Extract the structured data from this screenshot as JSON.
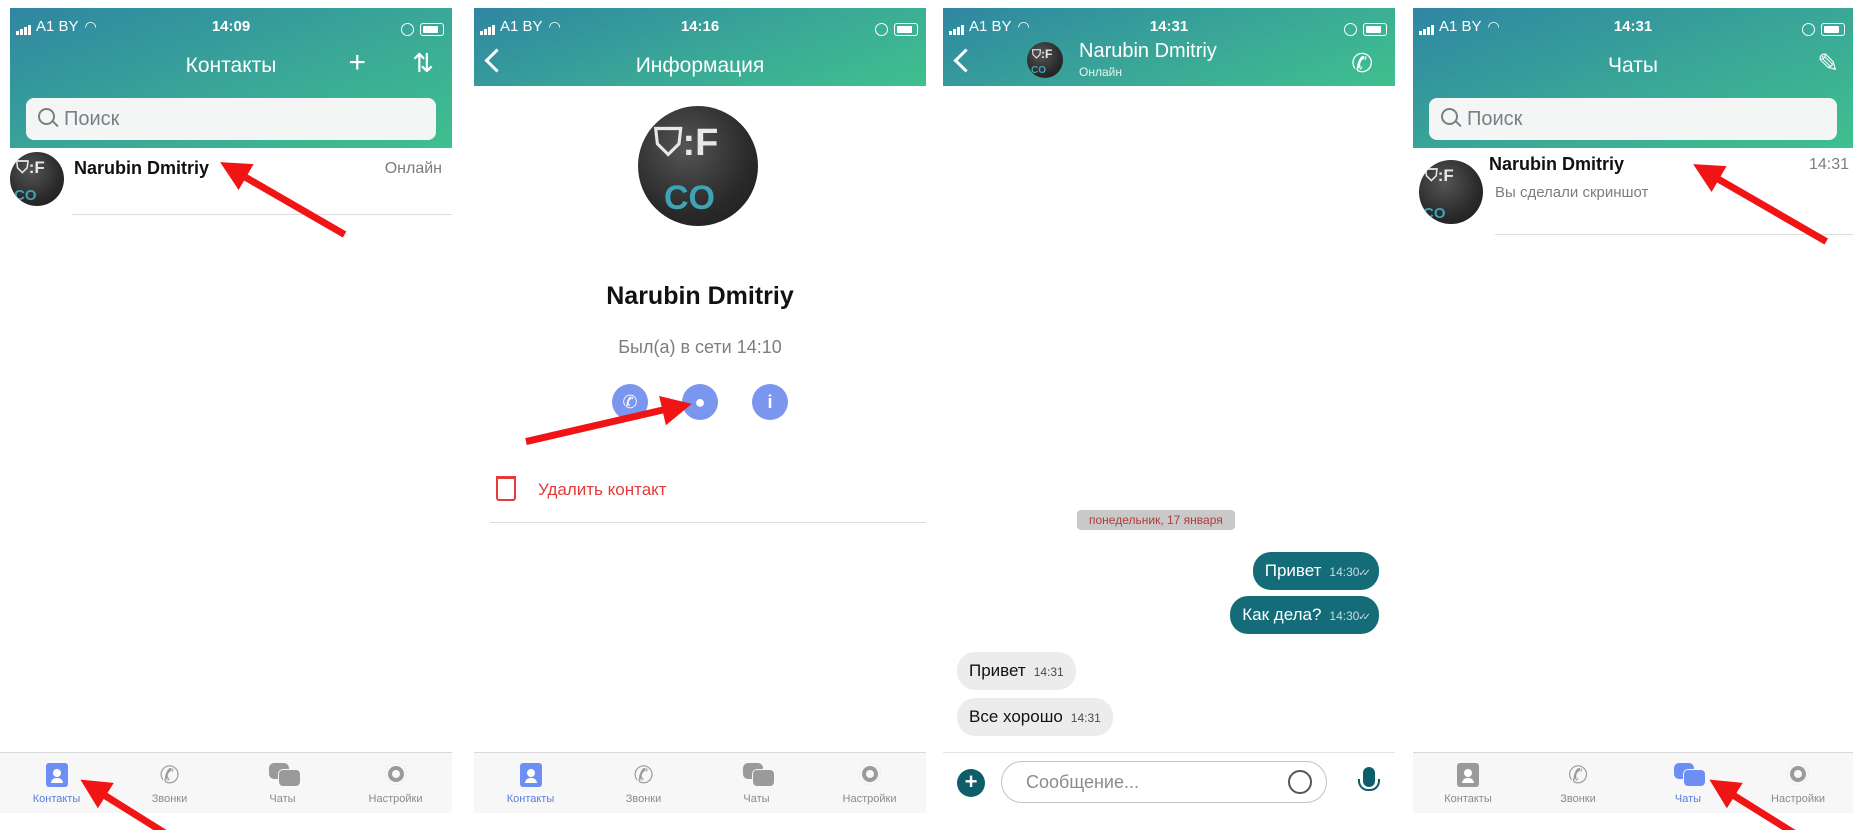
{
  "status": {
    "carrier": "A1 BY",
    "screen1_time": "14:09",
    "screen2_time": "14:16",
    "screen3_time": "14:31",
    "screen4_time": "14:31"
  },
  "contacts": {
    "title": "Контакты",
    "search_placeholder": "Поиск",
    "row": {
      "name": "Narubin Dmitriy",
      "status": "Онлайн"
    }
  },
  "info": {
    "title": "Информация",
    "name": "Narubin Dmitriy",
    "last_seen": "Был(а) в сети 14:10",
    "delete_label": "Удалить контакт"
  },
  "chat": {
    "contact_name": "Narubin Dmitriy",
    "contact_status": "Онлайн",
    "date_label": "понедельник, 17 января",
    "messages": [
      {
        "text": "Привет",
        "time": "14:30",
        "direction": "out"
      },
      {
        "text": "Как дела?",
        "time": "14:30",
        "direction": "out"
      },
      {
        "text": "Привет",
        "time": "14:31",
        "direction": "in"
      },
      {
        "text": "Все хорошо",
        "time": "14:31",
        "direction": "in"
      }
    ],
    "input_placeholder": "Сообщение..."
  },
  "chats": {
    "title": "Чаты",
    "search_placeholder": "Поиск",
    "row": {
      "name": "Narubin Dmitriy",
      "preview": "Вы сделали скриншот",
      "time": "14:31"
    }
  },
  "tabbar": {
    "contacts": "Контакты",
    "calls": "Звонки",
    "chats": "Чаты",
    "settings": "Настройки"
  },
  "colors": {
    "accent": "#6d8ef2",
    "header_gradient_start": "#2f86a2",
    "header_gradient_end": "#3fc08e",
    "outgoing_bubble": "#146c79",
    "danger": "#e23b3b",
    "annotation_arrow": "#f01414"
  }
}
